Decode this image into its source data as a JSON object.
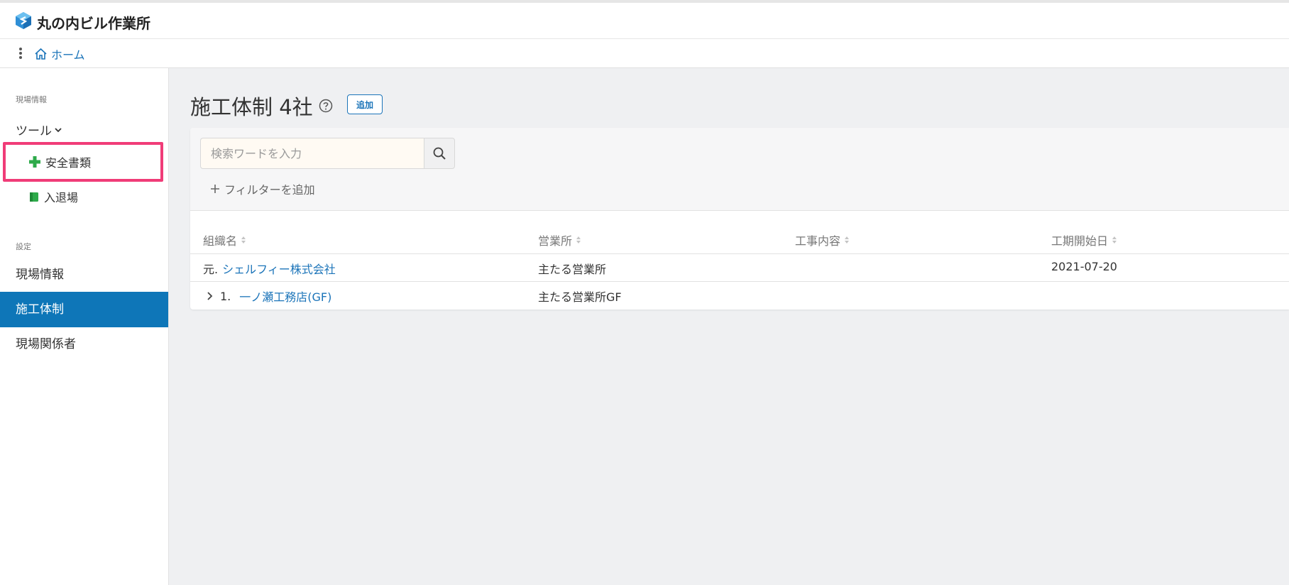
{
  "header": {
    "site_title": "丸の内ビル作業所"
  },
  "breadcrumb": {
    "home_label": "ホーム"
  },
  "sidebar": {
    "section_site_info": "現場情報",
    "tools_label": "ツール",
    "tools_items": [
      {
        "label": "安全書類",
        "icon": "green-plus-icon"
      },
      {
        "label": "入退場",
        "icon": "green-book-icon"
      }
    ],
    "section_settings": "設定",
    "nav_items": [
      {
        "label": "現場情報",
        "active": false
      },
      {
        "label": "施工体制",
        "active": true
      },
      {
        "label": "現場関係者",
        "active": false
      }
    ]
  },
  "main": {
    "title": "施工体制 4社",
    "add_button": "追加",
    "search": {
      "placeholder": "検索ワードを入力",
      "value": ""
    },
    "add_filter": "フィルターを追加",
    "columns": [
      "組織名",
      "営業所",
      "工事内容",
      "工期開始日"
    ],
    "rows": [
      {
        "prefix": "元.",
        "org": "シェルフィー株式会社",
        "office": "主たる営業所",
        "work": "",
        "start": "2021-07-20",
        "expandable": false
      },
      {
        "prefix": "1.",
        "org": "一ノ瀬工務店(GF)",
        "office": "主たる営業所GF",
        "work": "",
        "start": "",
        "expandable": true
      }
    ]
  },
  "colors": {
    "accent": "#0e76b8",
    "link": "#1b74b9",
    "highlight": "#f03c78",
    "green": "#2eaa4a"
  }
}
